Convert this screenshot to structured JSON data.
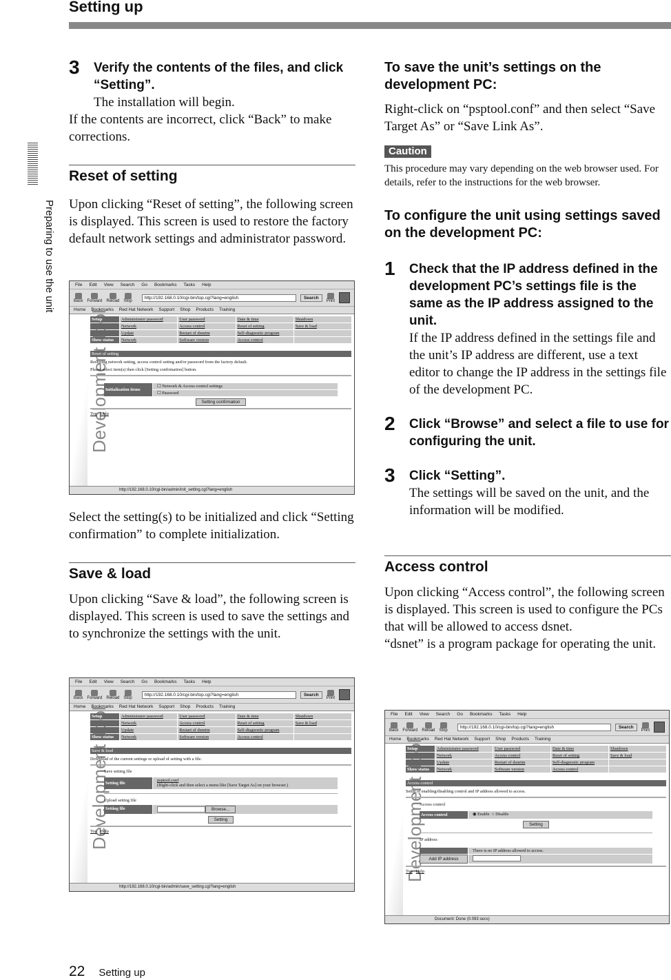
{
  "header": {
    "title": "Setting up"
  },
  "side_tab": "Preparing to use the unit",
  "footer": {
    "page": "22",
    "section": "Setting up"
  },
  "left": {
    "step3": {
      "num": "3",
      "title": "Verify the contents of the files, and click “Setting”.",
      "body": "The installation will begin."
    },
    "step3_note": "If the contents are incorrect, click “Back” to make corrections.",
    "reset": {
      "heading": "Reset of setting",
      "body": "Upon clicking “Reset of setting”, the following screen is displayed. This screen is used to restore the factory default network settings and administrator password.",
      "after": "Select the setting(s) to be initialized and click “Setting confirmation” to complete initialization."
    },
    "save": {
      "heading": "Save & load",
      "body": "Upon clicking “Save & load”, the following screen is displayed. This screen is used to save the settings and to synchronize the settings with the unit."
    }
  },
  "right": {
    "save_pc": {
      "heading": "To save the unit’s settings on the development PC:",
      "body": "Right-click on “psptool.conf” and then select “Save Target As” or “Save Link As”."
    },
    "caution": {
      "label": "Caution",
      "text": "This procedure may vary depending on the web browser used. For details, refer to the instructions for the web browser."
    },
    "configure": {
      "heading": "To configure the unit using settings saved on the development PC:",
      "steps": [
        {
          "num": "1",
          "title": "Check that the IP address defined in the development PC’s settings file is the same as the IP address assigned to the unit.",
          "body": "If the IP address defined in the settings file and the unit’s IP address are different, use a text editor to change the IP address in the settings file of the development PC."
        },
        {
          "num": "2",
          "title": "Click “Browse” and select a file to use for configuring the unit.",
          "body": ""
        },
        {
          "num": "3",
          "title": "Click “Setting”.",
          "body": "The settings will be saved on the unit, and the information will be modified."
        }
      ]
    },
    "access": {
      "heading": "Access control",
      "body1": "Upon clicking “Access control”, the following screen is displayed. This screen is used to configure the PCs that will be allowed to access dsnet.",
      "body2": "“dsnet” is a program package for operating the unit."
    }
  },
  "chrome": {
    "menu": [
      "File",
      "Edit",
      "View",
      "Search",
      "Go",
      "Bookmarks",
      "Tasks",
      "Help"
    ],
    "toolbar": [
      "Back",
      "Forward",
      "Reload",
      "Stop"
    ],
    "url": "http://192.168.0.10/cgi-bin/top.cgi?lang=english",
    "search": "Search",
    "print": "Print",
    "personal": [
      "Home",
      "Bookmarks",
      "Red Hat Network",
      "Support",
      "Shop",
      "Products",
      "Training"
    ],
    "side_title": "Development Tool",
    "nav": {
      "setup": "Setup",
      "show_status": "Show status",
      "items": [
        "Administrator password",
        "User password",
        "Date & time",
        "Shutdown",
        "Network",
        "Access control",
        "Reset of setting",
        "Save & load",
        "Update",
        "Restart of dsnetm",
        "Self-diagnostic program",
        "",
        "Network",
        "Software version",
        "Access control",
        ""
      ]
    },
    "top": "Top",
    "help": "Help"
  },
  "browsers": [
    {
      "status": "http://192.168.0.10/cgi-bin/admin/init_setting.cgi?lang=english",
      "bar": "Reset of setting",
      "p1": "Restoring network setting, access control setting and/or password from the factory default.",
      "p2": "Please select item(s) then click [Setting confirmation] button.",
      "items_label": "Initialization items",
      "opt1": "Network & Access control settings",
      "opt2": "Password",
      "button": "Setting confirmation"
    },
    {
      "status": "http://192.168.0.10/cgi-bin/admin/save_setting.cgi?lang=english",
      "bar": "Save & load",
      "p1": "Download of the current settings or upload of setting with a file.",
      "save_title": "Save setting file",
      "file_label": "Setting file",
      "file_link": "psptool.conf",
      "file_note": "(Right-click and then select a menu like [Save Target As] on your browser.)",
      "upload_title": "Upload setting file",
      "browse": "Browse...",
      "button": "Setting"
    },
    {
      "status": "Document: Done (0.093 secs)",
      "bar": "Access control",
      "p1": "Setup of enabling/disabling control and IP address allowed to access.",
      "ac_title": "Access control",
      "ac_label": "Access control",
      "enable": "Enable",
      "disable": "Disable",
      "enable_selected": true,
      "button": "Setting",
      "ip_title": "IP address",
      "ip_none": "There is no IP address allowed to access.",
      "add_ip": "Add IP address"
    }
  ]
}
